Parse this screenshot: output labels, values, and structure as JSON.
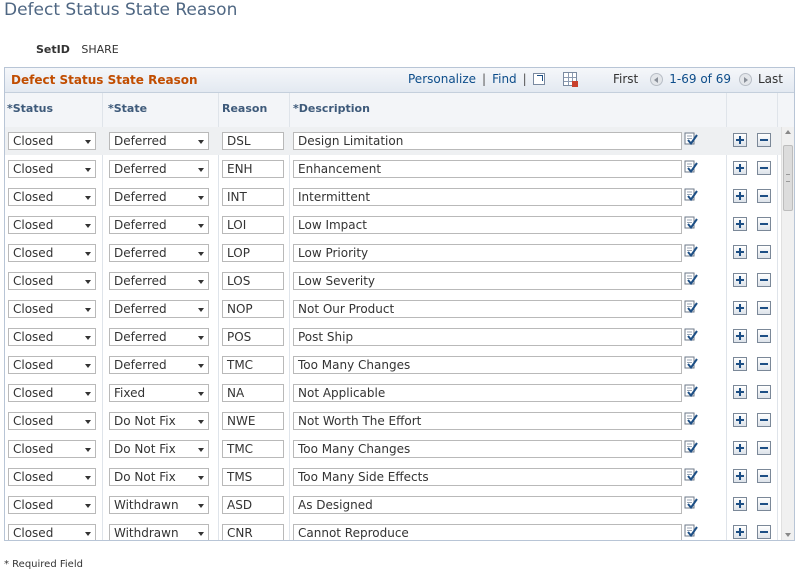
{
  "page": {
    "title": "Defect Status State Reason"
  },
  "setid": {
    "label": "SetID",
    "value": "SHARE"
  },
  "grid": {
    "title": "Defect Status State Reason",
    "personalize": "Personalize",
    "find": "Find",
    "separator": "|",
    "nav": {
      "first": "First",
      "range": "1-69 of 69",
      "last": "Last"
    },
    "columns": {
      "status": "*Status",
      "state": "*State",
      "reason": "Reason",
      "description": "*Description"
    },
    "rows": [
      {
        "status": "Closed",
        "state": "Deferred",
        "reason": "DSL",
        "description": "Design Limitation"
      },
      {
        "status": "Closed",
        "state": "Deferred",
        "reason": "ENH",
        "description": "Enhancement"
      },
      {
        "status": "Closed",
        "state": "Deferred",
        "reason": "INT",
        "description": "Intermittent"
      },
      {
        "status": "Closed",
        "state": "Deferred",
        "reason": "LOI",
        "description": "Low Impact"
      },
      {
        "status": "Closed",
        "state": "Deferred",
        "reason": "LOP",
        "description": "Low Priority"
      },
      {
        "status": "Closed",
        "state": "Deferred",
        "reason": "LOS",
        "description": "Low Severity"
      },
      {
        "status": "Closed",
        "state": "Deferred",
        "reason": "NOP",
        "description": "Not Our Product"
      },
      {
        "status": "Closed",
        "state": "Deferred",
        "reason": "POS",
        "description": "Post Ship"
      },
      {
        "status": "Closed",
        "state": "Deferred",
        "reason": "TMC",
        "description": "Too Many Changes"
      },
      {
        "status": "Closed",
        "state": "Fixed",
        "reason": "NA",
        "description": "Not Applicable"
      },
      {
        "status": "Closed",
        "state": "Do Not Fix",
        "reason": "NWE",
        "description": "Not Worth The Effort"
      },
      {
        "status": "Closed",
        "state": "Do Not Fix",
        "reason": "TMC",
        "description": "Too Many Changes"
      },
      {
        "status": "Closed",
        "state": "Do Not Fix",
        "reason": "TMS",
        "description": "Too Many Side Effects"
      },
      {
        "status": "Closed",
        "state": "Withdrawn",
        "reason": "ASD",
        "description": "As Designed"
      },
      {
        "status": "Closed",
        "state": "Withdrawn",
        "reason": "CNR",
        "description": "Cannot Reproduce"
      }
    ]
  },
  "footnote": "* Required Field",
  "icons": {
    "zoom": "zoom-icon",
    "download": "download-grid-icon",
    "previous": "previous-arrow-icon",
    "next": "next-arrow-icon",
    "spellcheck": "spellcheck-icon",
    "add": "add-row-icon",
    "delete": "delete-row-icon"
  },
  "colors": {
    "title": "#4f6783",
    "grid_title": "#c14d00",
    "link": "#0d4d8a",
    "column_header": "#3e5a7a"
  }
}
